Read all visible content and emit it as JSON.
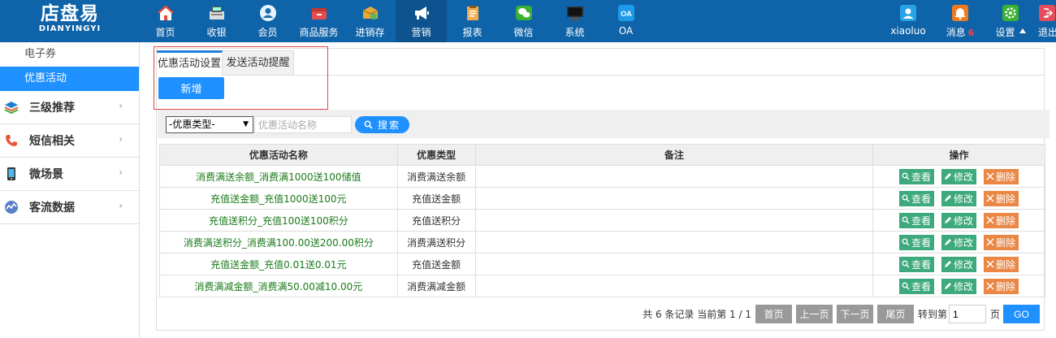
{
  "logo": {
    "text_cn": "店盘易",
    "text_en": "DIANYINGYI"
  },
  "nav": {
    "items": [
      {
        "label": "首页",
        "icon": "home-icon"
      },
      {
        "label": "收银",
        "icon": "cashier-icon"
      },
      {
        "label": "会员",
        "icon": "member-icon"
      },
      {
        "label": "商品服务",
        "icon": "goods-icon"
      },
      {
        "label": "进销存",
        "icon": "inventory-icon"
      },
      {
        "label": "营销",
        "icon": "megaphone-icon"
      },
      {
        "label": "报表",
        "icon": "report-icon"
      },
      {
        "label": "微信",
        "icon": "wechat-icon"
      },
      {
        "label": "系统",
        "icon": "monitor-icon"
      },
      {
        "label": "OA",
        "icon": "oa-icon"
      }
    ],
    "active_index": 5
  },
  "user_nav": {
    "username": "xiaoluo",
    "messages_label": "消息",
    "messages_count": "6",
    "settings_label": "设置",
    "logout_label": "退出"
  },
  "sidebar": {
    "sub_items": [
      {
        "label": "电子券"
      },
      {
        "label": "优惠活动",
        "active": true
      }
    ],
    "menu": [
      {
        "label": "三级推荐",
        "icon": "layers-icon"
      },
      {
        "label": "短信相关",
        "icon": "phone-icon"
      },
      {
        "label": "微场景",
        "icon": "mobile-icon"
      },
      {
        "label": "客流数据",
        "icon": "chart-icon"
      }
    ]
  },
  "tabs": {
    "items": [
      {
        "label": "优惠活动设置"
      },
      {
        "label": "发送活动提醒"
      }
    ],
    "active_index": 0
  },
  "add_button": "新增",
  "filter": {
    "type_select_value": "-优惠类型-",
    "name_placeholder": "优惠活动名称",
    "search_label": "搜索"
  },
  "table": {
    "headers": [
      "优惠活动名称",
      "优惠类型",
      "备注",
      "操作"
    ],
    "rows": [
      {
        "name": "消费满送余额_消费满1000送100储值",
        "type": "消费满送余额",
        "note": ""
      },
      {
        "name": "充值送金额_充值1000送100元",
        "type": "充值送金额",
        "note": ""
      },
      {
        "name": "充值送积分_充值100送100积分",
        "type": "充值送积分",
        "note": ""
      },
      {
        "name": "消费满送积分_消费满100.00送200.00积分",
        "type": "消费满送积分",
        "note": ""
      },
      {
        "name": "充值送金额_充值0.01送0.01元",
        "type": "充值送金额",
        "note": ""
      },
      {
        "name": "消费满减金额_消费满50.00减10.00元",
        "type": "消费满减金额",
        "note": ""
      }
    ],
    "actions": {
      "view": "查看",
      "edit": "修改",
      "delete": "删除"
    }
  },
  "pager": {
    "summary": "共 6 条记录 当前第 1 / 1",
    "first": "首页",
    "prev": "上一页",
    "next": "下一页",
    "last": "尾页",
    "goto_label": "转到第",
    "page_value": "1",
    "page_suffix": "页",
    "go": "GO"
  },
  "colors": {
    "topbar": "#0f63a8",
    "accent": "#1e90ff",
    "view_edit_button": "#3da97c",
    "delete_button": "#ea8745",
    "activity_name": "#1a7a1a",
    "highlight_box": "#e2454b"
  }
}
